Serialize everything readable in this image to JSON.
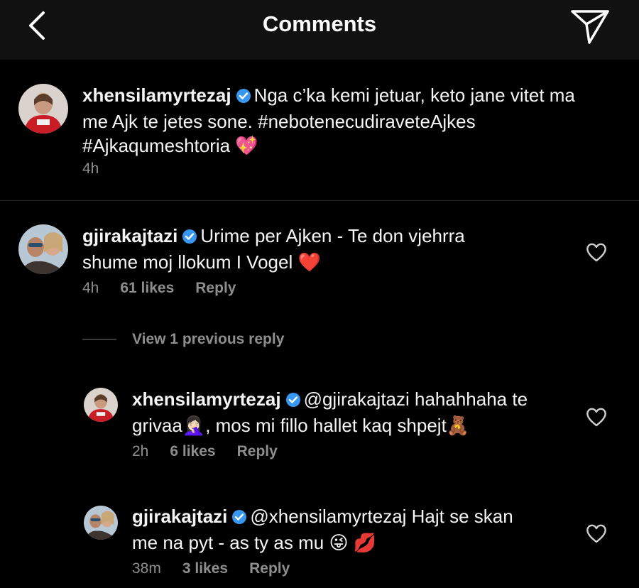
{
  "header": {
    "title": "Comments",
    "back_icon": "chevron-left-icon",
    "send_icon": "paper-plane-icon"
  },
  "caption": {
    "username": "xhensilamyrtezaj",
    "text_line1": "Nga c’ka kemi jetuar, keto jane vitet ma",
    "text_line2": "me Ajk te jetes sone. #nebotenecudiraveteAjkes",
    "text_line3": "#Ajkaqumeshtoria",
    "emoji": "💖",
    "time": "4h"
  },
  "comments": [
    {
      "username": "gjirakajtazi",
      "text_line1": "Urime per Ajken - Te don vjehrra",
      "text_line2": "shume moj llokum I Vogel",
      "emoji": "❤️",
      "time": "4h",
      "likes": "61 likes",
      "reply": "Reply"
    }
  ],
  "view_previous": "View 1 previous reply",
  "replies": [
    {
      "username": "xhensilamyrtezaj",
      "text_line1": "@gjirakajtazi hahahhaha te",
      "text_line2a": "grivaa",
      "emoji_a": "🤦🏻‍♀️",
      "text_line2b": ", mos mi fillo hallet kaq shpejt",
      "emoji_b": "🧸",
      "time": "2h",
      "likes": "6 likes",
      "reply": "Reply"
    },
    {
      "username": "gjirakajtazi",
      "text_line1": "@xhensilamyrtezaj Hajt se skan",
      "text_line2": "me na pyt - as ty as mu",
      "emoji_a": "😜",
      "emoji_b": "💋",
      "time": "38m",
      "likes": "3 likes",
      "reply": "Reply"
    }
  ],
  "colors": {
    "background": "#000000",
    "header": "#111111",
    "muted": "#8e8e8e",
    "verified": "#3897f0",
    "heart_red": "#ed4956"
  }
}
